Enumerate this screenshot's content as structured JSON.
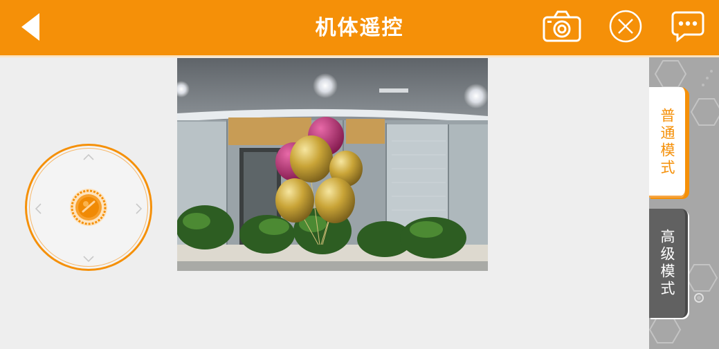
{
  "header": {
    "title": "机体遥控",
    "back_icon": "chevron-left-icon",
    "camera_icon": "camera-icon",
    "close_icon": "close-circle-icon",
    "message_icon": "chat-bubble-icon"
  },
  "video": {
    "content": "live-camera-feed"
  },
  "joystick": {
    "up_icon": "↑",
    "down_icon": "↓",
    "left_icon": "←",
    "right_icon": "→"
  },
  "modes": {
    "normal_label": "普通模式",
    "advanced_label": "高级模式",
    "selected": "normal"
  },
  "colors": {
    "accent": "#f59008",
    "header_text": "#ffffff",
    "panel_bg": "#a7a7a7",
    "advanced_bg": "#616161"
  }
}
